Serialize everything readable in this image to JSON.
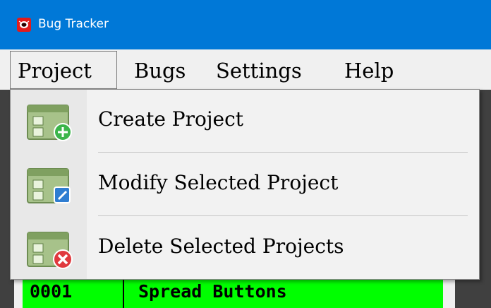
{
  "window": {
    "title": "Bug Tracker"
  },
  "menubar": {
    "items": [
      {
        "label": "Project"
      },
      {
        "label": "Bugs"
      },
      {
        "label": "Settings"
      },
      {
        "label": "Help"
      }
    ]
  },
  "project_menu": {
    "items": [
      {
        "label": "Create Project",
        "icon": "create-project-icon"
      },
      {
        "label": "Modify Selected Project",
        "icon": "modify-project-icon"
      },
      {
        "label": "Delete Selected Projects",
        "icon": "delete-project-icon"
      }
    ]
  },
  "project_table": {
    "rows": [
      {
        "id": "0001",
        "name": "Spread Buttons"
      }
    ]
  },
  "colors": {
    "titlebar": "#0078d7",
    "selected_row": "#00ff00"
  }
}
